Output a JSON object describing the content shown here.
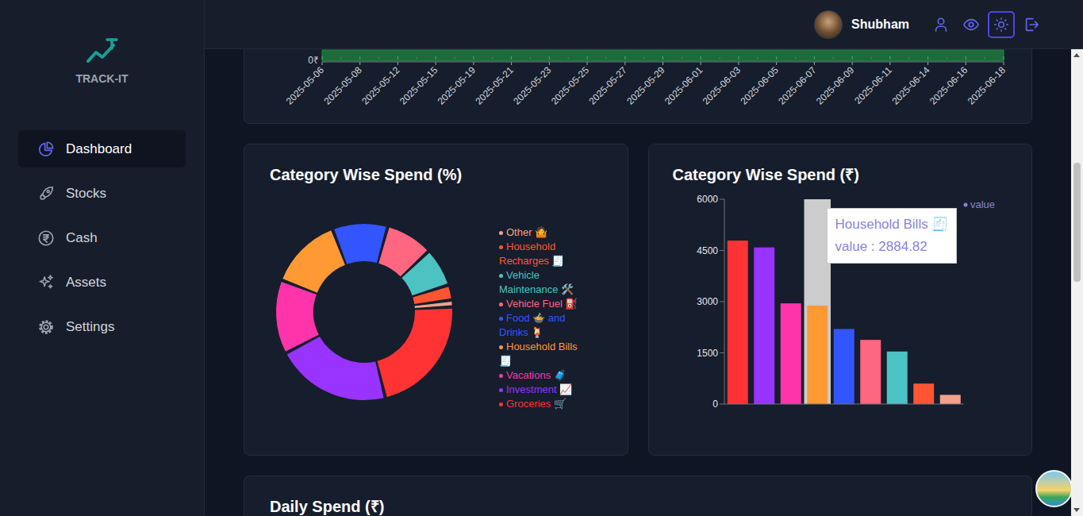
{
  "sidebar": {
    "logo": "TRACK-IT",
    "items": [
      {
        "label": "Dashboard",
        "selected": true
      },
      {
        "label": "Stocks",
        "selected": false
      },
      {
        "label": "Cash",
        "selected": false
      },
      {
        "label": "Assets",
        "selected": false
      },
      {
        "label": "Settings",
        "selected": false
      }
    ]
  },
  "header": {
    "user": "Shubham",
    "buttons": [
      {
        "selected": false
      },
      {
        "selected": false
      },
      {
        "selected": true
      },
      {
        "selected": false
      }
    ]
  },
  "trend_chart": {
    "y_tick": "0₹",
    "dates": [
      "2025-05-06",
      "2025-05-08",
      "2025-05-12",
      "2025-05-15",
      "2025-05-19",
      "2025-05-21",
      "2025-05-23",
      "2025-05-25",
      "2025-05-27",
      "2025-05-29",
      "2025-06-01",
      "2025-06-03",
      "2025-06-05",
      "2025-06-07",
      "2025-06-09",
      "2025-06-11",
      "2025-06-14",
      "2025-06-16",
      "2025-06-18"
    ]
  },
  "category_percent": {
    "title": "Category Wise Spend (%)",
    "slices": [
      {
        "value": 2200,
        "color": "#3355ff"
      },
      {
        "value": 1880,
        "color": "#ff6680"
      },
      {
        "value": 1540,
        "color": "#4cc2c2"
      },
      {
        "value": 600,
        "color": "#ff5533"
      },
      {
        "value": 270,
        "color": "#f4a08a"
      },
      {
        "value": 4790,
        "color": "#ff3333"
      },
      {
        "value": 4590,
        "color": "#9933ff"
      },
      {
        "value": 2950,
        "color": "#ff33aa"
      },
      {
        "value": 2884.82,
        "color": "#ff9933"
      }
    ],
    "legend": [
      {
        "label": "Other 🤷",
        "color": "#f4a08a"
      },
      {
        "label": "Household Recharges 🧾",
        "color": "#ff5533"
      },
      {
        "label": "Vehicle Maintenance 🛠️",
        "color": "#4cc2c2"
      },
      {
        "label": "Vehicle Fuel ⛽",
        "color": "#ff6680"
      },
      {
        "label": "Food 🍲 and Drinks 🍹",
        "color": "#3355ff"
      },
      {
        "label": "Household Bills 🧾",
        "color": "#ff9933"
      },
      {
        "label": "Vacations 🧳",
        "color": "#ff33aa"
      },
      {
        "label": "Investment 📈",
        "color": "#9933ff"
      },
      {
        "label": "Groceries 🛒",
        "color": "#ff3333"
      }
    ]
  },
  "category_amount": {
    "title": "Category Wise Spend (₹)",
    "y_ticks": [
      "6000",
      "4500",
      "3000",
      "1500",
      "0"
    ],
    "y_max": 6000,
    "legend": "value",
    "bars": [
      {
        "value": 4790,
        "color": "#ff3333",
        "hovered": false
      },
      {
        "value": 4590,
        "color": "#9933ff",
        "hovered": false
      },
      {
        "value": 2950,
        "color": "#ff33aa",
        "hovered": false
      },
      {
        "value": 2884.82,
        "color": "#ff9933",
        "hovered": true
      },
      {
        "value": 2200,
        "color": "#3355ff",
        "hovered": false
      },
      {
        "value": 1880,
        "color": "#ff6680",
        "hovered": false
      },
      {
        "value": 1540,
        "color": "#4cc2c2",
        "hovered": false
      },
      {
        "value": 600,
        "color": "#ff5533",
        "hovered": false
      },
      {
        "value": 270,
        "color": "#f4a08a",
        "hovered": false
      }
    ],
    "tooltip": {
      "title": "Household Bills 🧾",
      "value": "value : 2884.82"
    }
  },
  "daily_spend": {
    "title": "Daily Spend (₹)"
  }
}
